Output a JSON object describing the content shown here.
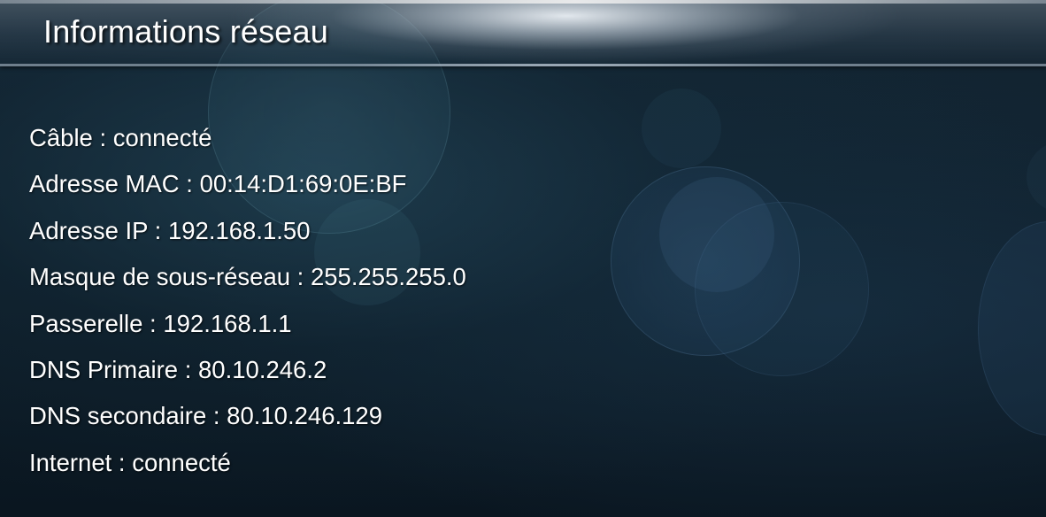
{
  "header": {
    "title": "Informations réseau"
  },
  "network_info": {
    "separator": " : ",
    "rows": [
      {
        "label": "Câble",
        "value": "connecté"
      },
      {
        "label": "Adresse MAC",
        "value": "00:14:D1:69:0E:BF"
      },
      {
        "label": "Adresse IP",
        "value": "192.168.1.50"
      },
      {
        "label": "Masque de sous-réseau",
        "value": "255.255.255.0"
      },
      {
        "label": "Passerelle",
        "value": "192.168.1.1"
      },
      {
        "label": "DNS Primaire",
        "value": "80.10.246.2"
      },
      {
        "label": "DNS secondaire",
        "value": "80.10.246.129"
      },
      {
        "label": "Internet",
        "value": "connecté"
      }
    ]
  },
  "colors": {
    "text": "#ffffff",
    "background": "#0f1f2b"
  }
}
